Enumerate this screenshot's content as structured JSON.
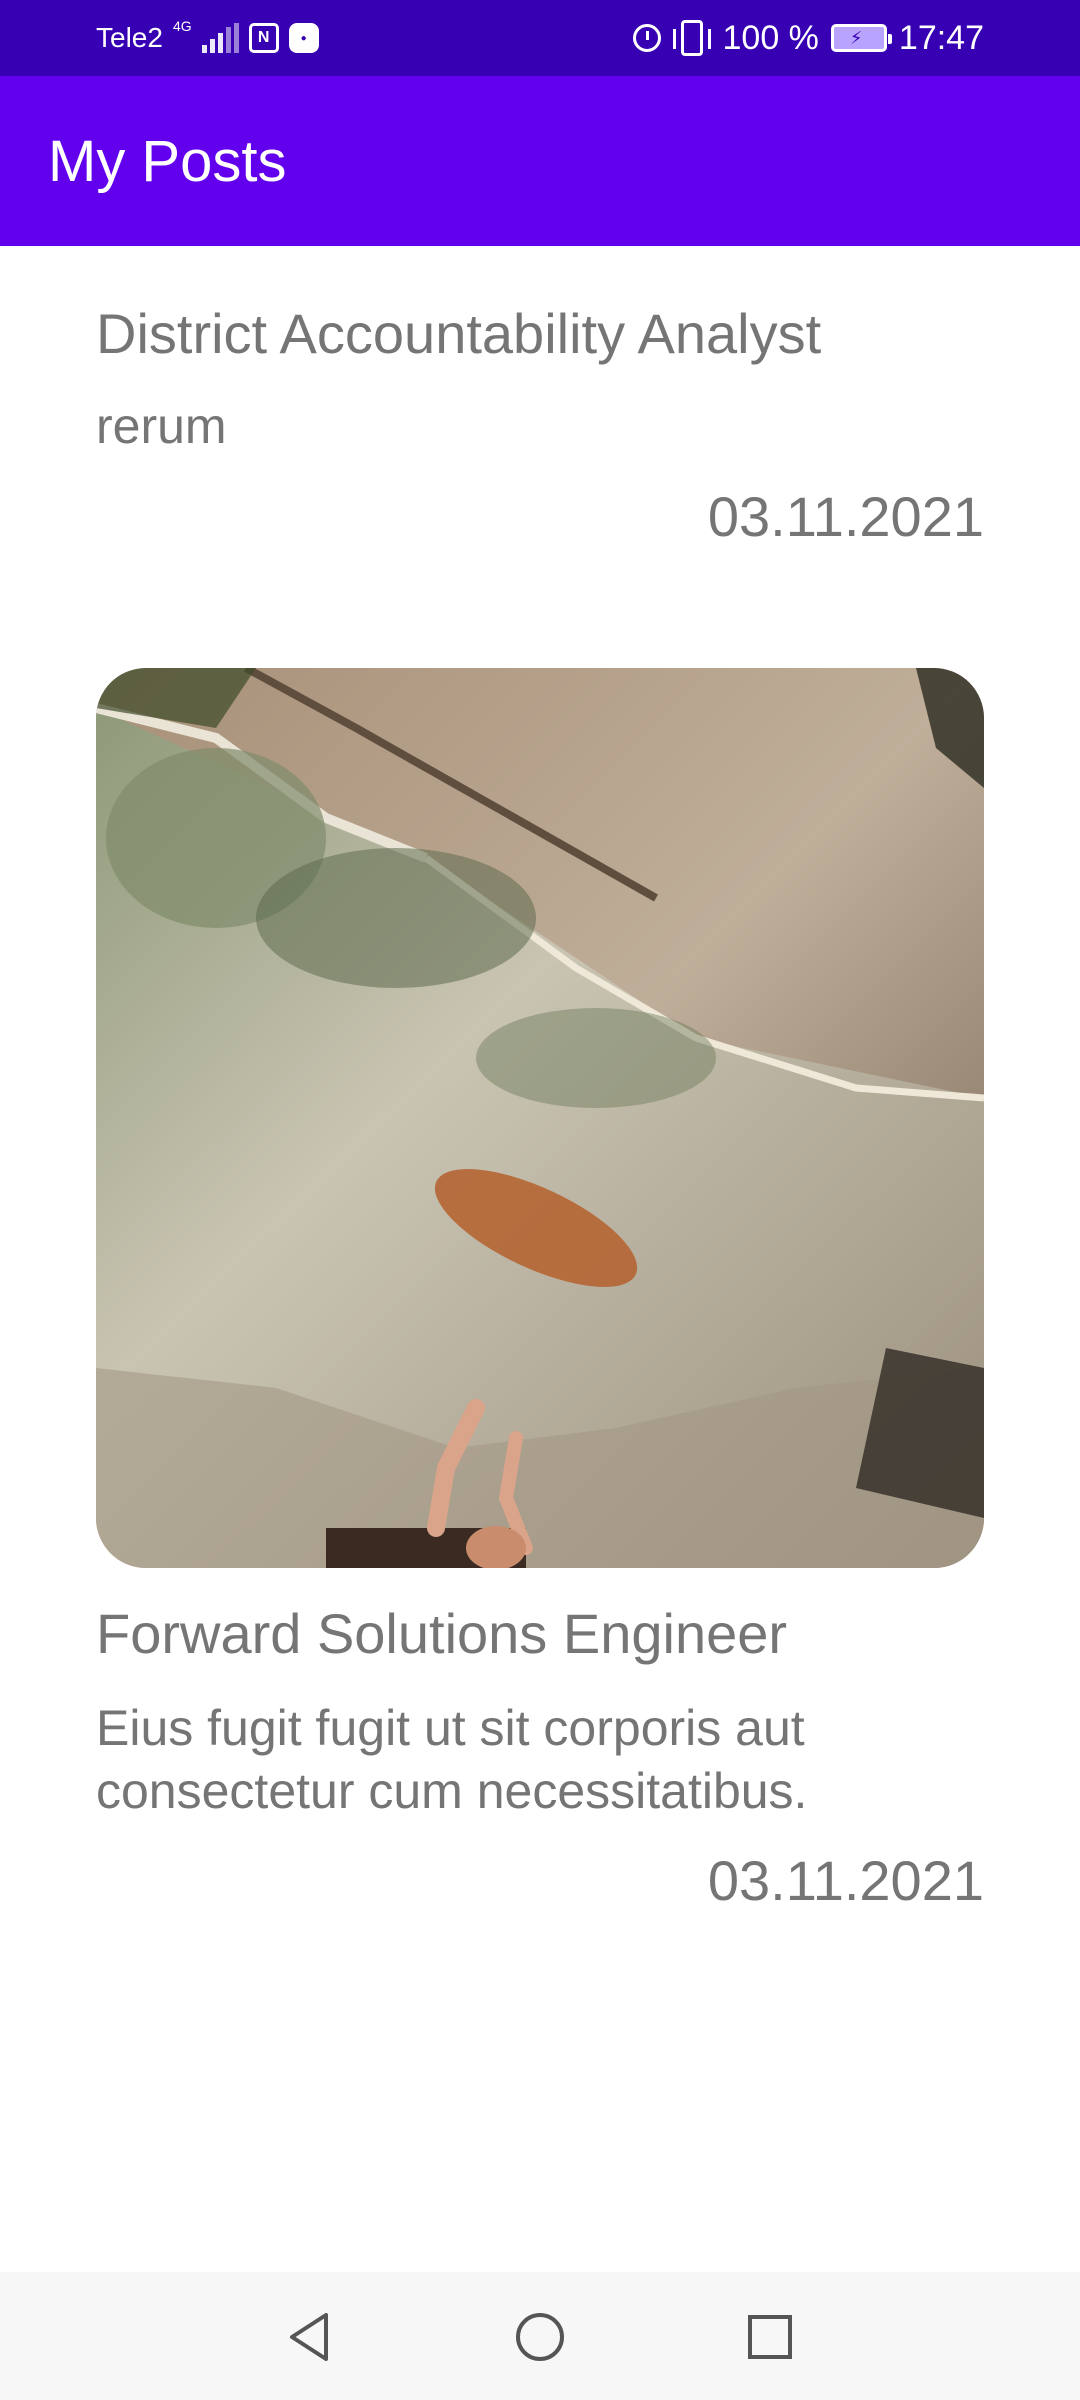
{
  "status_bar": {
    "carrier": "Tele2",
    "network": "4G",
    "nfc_icon": "nfc-icon",
    "battery_text": "100 %",
    "time": "17:47",
    "icons": [
      "signal-icon",
      "nfc-icon",
      "app-notification-icon",
      "alarm-icon",
      "vibrate-icon",
      "battery-icon"
    ],
    "battery_level": 1.0
  },
  "app_bar": {
    "title": "My Posts"
  },
  "posts": [
    {
      "title": "District Accountability Analyst",
      "body": "rerum",
      "date": "03.11.2021"
    },
    {
      "title": "Forward Solutions Engineer",
      "body": "Eius fugit fugit ut sit corporis aut consectetur cum necessitatibus.",
      "date": "03.11.2021",
      "image": "rock-climbing-photo"
    }
  ],
  "nav_bar": {
    "back_icon": "back-triangle-icon",
    "home_icon": "home-circle-icon",
    "recents_icon": "recents-square-icon"
  },
  "colors": {
    "status_bar": "#3700b3",
    "app_bar": "#6200ee",
    "text_secondary": "#757575"
  }
}
